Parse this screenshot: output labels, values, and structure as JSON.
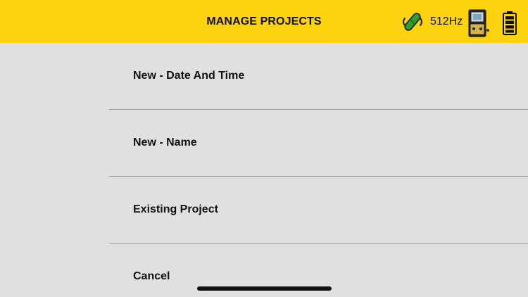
{
  "header": {
    "title": "MANAGE PROJECTS",
    "frequency": "512Hz",
    "background_color": "#fdd20e",
    "icons": [
      "probe-signal-icon",
      "detector-device-icon",
      "battery-icon"
    ]
  },
  "menu": {
    "items": [
      {
        "label": "New - Date And Time"
      },
      {
        "label": "New - Name"
      },
      {
        "label": "Existing Project"
      },
      {
        "label": "Cancel"
      }
    ]
  },
  "colors": {
    "accent": "#fdd20e",
    "background": "#e0e0e0",
    "divider": "#9a9a9a",
    "probe_green": "#2f9e2f"
  }
}
